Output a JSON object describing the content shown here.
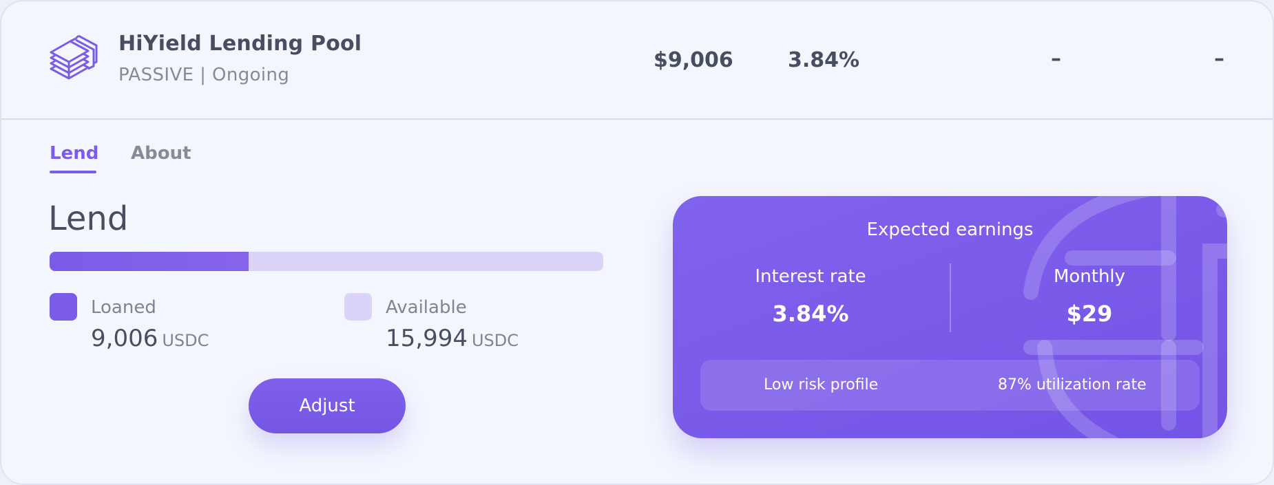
{
  "pool": {
    "name": "HiYield Lending Pool",
    "subtitle": "PASSIVE | Ongoing",
    "logo_icon": "stacked-layers-icon",
    "total_value": "$9,006",
    "apy": "3.84%",
    "col3": "–",
    "col4": "–"
  },
  "tabs": [
    {
      "label": "Lend",
      "active": true
    },
    {
      "label": "About",
      "active": false
    }
  ],
  "lend": {
    "heading": "Lend",
    "loaned_fraction": 0.36,
    "loaned": {
      "label": "Loaned",
      "value": "9,006",
      "unit": "USDC"
    },
    "available": {
      "label": "Available",
      "value": "15,994",
      "unit": "USDC"
    },
    "adjust_label": "Adjust"
  },
  "earnings": {
    "title": "Expected earnings",
    "interest_label": "Interest rate",
    "interest_value": "3.84%",
    "monthly_label": "Monthly",
    "monthly_value": "$29",
    "risk": "Low risk profile",
    "utilization": "87% utilization rate"
  },
  "colors": {
    "accent": "#7a5ce8",
    "accent_light": "#dbd4f8",
    "text_dark": "#474e60",
    "text_muted": "#858a99"
  }
}
